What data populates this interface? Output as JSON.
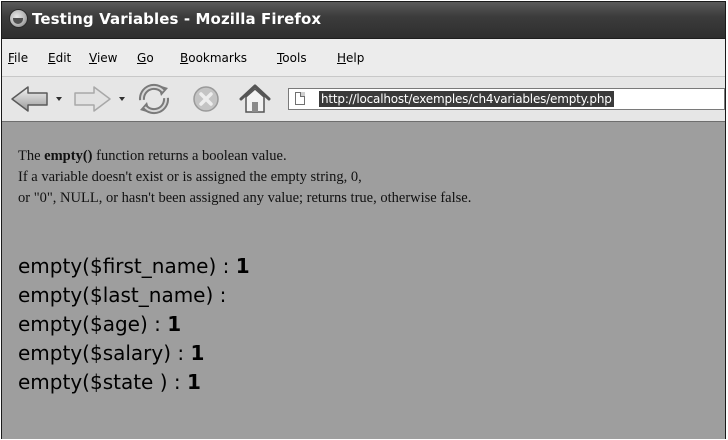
{
  "window": {
    "title": "Testing Variables - Mozilla Firefox"
  },
  "menu": {
    "items": [
      {
        "first": "F",
        "rest": "ile"
      },
      {
        "first": "E",
        "rest": "dit"
      },
      {
        "first": "V",
        "rest": "iew"
      },
      {
        "first": "G",
        "rest": "o"
      },
      {
        "first": "B",
        "rest": "ookmarks"
      },
      {
        "first": "T",
        "rest": "ools"
      },
      {
        "first": "H",
        "rest": "elp"
      }
    ]
  },
  "toolbar": {
    "icons": [
      "back-icon",
      "forward-icon",
      "reload-icon",
      "stop-icon",
      "home-icon",
      "page-icon"
    ]
  },
  "address": {
    "url": "http://localhost/exemples/ch4variables/empty.php"
  },
  "content": {
    "line1_before": "The ",
    "line1_bold": "empty()",
    "line1_after": " function returns a boolean value.",
    "line2": "If a variable doesn't exist or is assigned the empty string, 0,",
    "line3": "or \"0\", NULL, or hasn't been assigned any value; returns true, otherwise false.",
    "results": [
      {
        "label": "empty($first_name) : ",
        "value": "1"
      },
      {
        "label": "empty($last_name) : ",
        "value": ""
      },
      {
        "label": "empty($age) : ",
        "value": "1"
      },
      {
        "label": "empty($salary) : ",
        "value": "1"
      },
      {
        "label": "empty($state ) : ",
        "value": "1"
      }
    ]
  },
  "colors": {
    "titlebar": "#3c3c3c",
    "content_background": "#9e9e9e",
    "url_highlight": "#3a3a3a"
  }
}
